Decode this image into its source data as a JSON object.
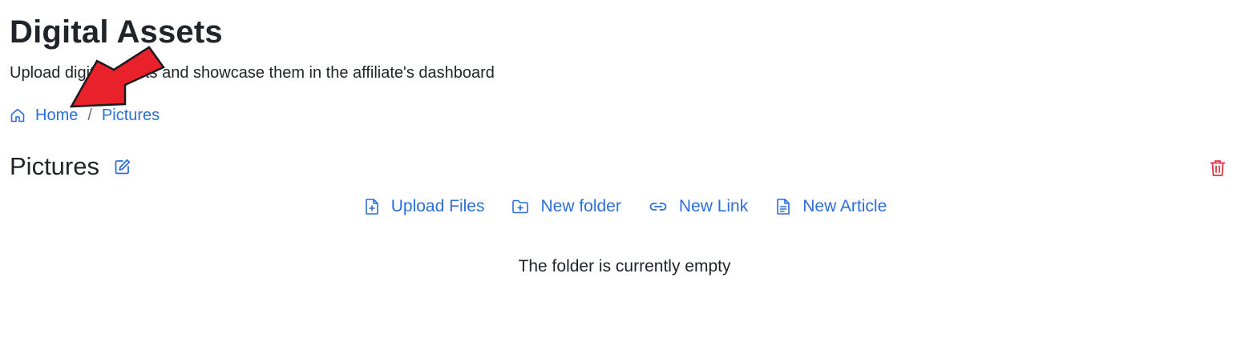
{
  "page": {
    "title": "Digital Assets",
    "subtitle": "Upload digital assets and showcase them in the affiliate's dashboard"
  },
  "breadcrumb": {
    "items": [
      {
        "label": "Home",
        "icon": "home-icon"
      },
      {
        "label": "Pictures"
      }
    ],
    "separator": "/"
  },
  "folder": {
    "title": "Pictures",
    "edit_icon": "edit-icon",
    "delete_icon": "trash-icon"
  },
  "actions": [
    {
      "label": "Upload Files",
      "icon": "file-plus-icon"
    },
    {
      "label": "New folder",
      "icon": "folder-plus-icon"
    },
    {
      "label": "New Link",
      "icon": "link-icon"
    },
    {
      "label": "New Article",
      "icon": "file-text-icon"
    }
  ],
  "empty_message": "The folder is currently empty",
  "colors": {
    "link": "#2b6fd8",
    "danger": "#dc3545",
    "annotation_arrow": "#e8212b"
  }
}
